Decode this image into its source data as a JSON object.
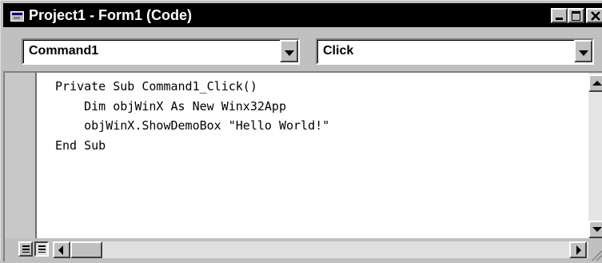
{
  "window": {
    "title": "Project1 - Form1 (Code)"
  },
  "object_combo": {
    "selected": "Command1"
  },
  "procedure_combo": {
    "selected": "Click"
  },
  "code": {
    "lines": [
      "Private Sub Command1_Click()",
      "    Dim objWinX As New Winx32App",
      "    objWinX.ShowDemoBox \"Hello World!\"",
      "End Sub"
    ]
  },
  "icons": {
    "window": "form-icon",
    "minimize": "minimize-icon",
    "maximize": "maximize-icon",
    "close": "close-icon",
    "combo_arrow": "chevron-down-icon",
    "procedure_view": "procedure-view-icon",
    "full_module_view": "full-module-view-icon"
  },
  "colors": {
    "title_bar": "#000000",
    "face": "#c0c0c0",
    "editor_background": "#ffffff"
  }
}
